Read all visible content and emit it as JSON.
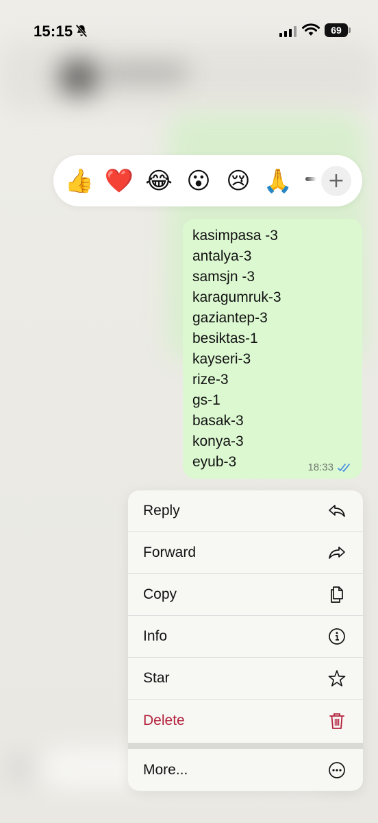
{
  "status_bar": {
    "time": "15:15",
    "battery": "69"
  },
  "reactions": {
    "emojis": [
      "👍",
      "❤️",
      "😂",
      "😮",
      "😢",
      "🙏"
    ],
    "more_label": "+"
  },
  "message": {
    "lines": [
      "kasimpasa -3",
      "antalya-3",
      "samsjn -3",
      "karagumruk-3",
      "gaziantep-3",
      "besiktas-1",
      "kayseri-3",
      "rize-3",
      "gs-1",
      "basak-3",
      "konya-3",
      "eyub-3"
    ],
    "time": "18:33",
    "status_icon": "double-check-icon"
  },
  "menu": {
    "items": [
      {
        "label": "Reply",
        "icon": "reply-icon"
      },
      {
        "label": "Forward",
        "icon": "forward-icon"
      },
      {
        "label": "Copy",
        "icon": "copy-icon"
      },
      {
        "label": "Info",
        "icon": "info-icon"
      },
      {
        "label": "Star",
        "icon": "star-icon"
      },
      {
        "label": "Delete",
        "icon": "trash-icon"
      },
      {
        "label": "More...",
        "icon": "more-icon"
      }
    ]
  },
  "colors": {
    "bubble": "#dcf8d1",
    "delete": "#b3213b",
    "ticks": "#4a90e2"
  }
}
